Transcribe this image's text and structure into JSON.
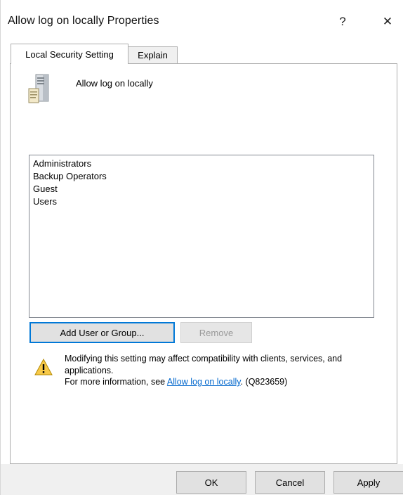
{
  "window": {
    "title": "Allow log on locally Properties",
    "help_glyph": "?",
    "close_glyph": "✕"
  },
  "tabs": [
    {
      "label": "Local Security Setting",
      "selected": true
    },
    {
      "label": "Explain",
      "selected": false
    }
  ],
  "policy": {
    "icon": "server-icon",
    "name": "Allow log on locally"
  },
  "principals": [
    "Administrators",
    "Backup Operators",
    "Guest",
    "Users"
  ],
  "buttons": {
    "add": "Add User or Group...",
    "remove": "Remove",
    "ok": "OK",
    "cancel": "Cancel",
    "apply": "Apply"
  },
  "warning": {
    "icon": "warning-icon",
    "line1": "Modifying this setting may affect compatibility with clients, services, and applications.",
    "more_prefix": "For more information, see ",
    "link_text": "Allow log on locally",
    "more_suffix": ". (Q823659)"
  },
  "colors": {
    "accent": "#0078d7",
    "link": "#0066cc",
    "footer_bg": "#f0f0f0"
  }
}
